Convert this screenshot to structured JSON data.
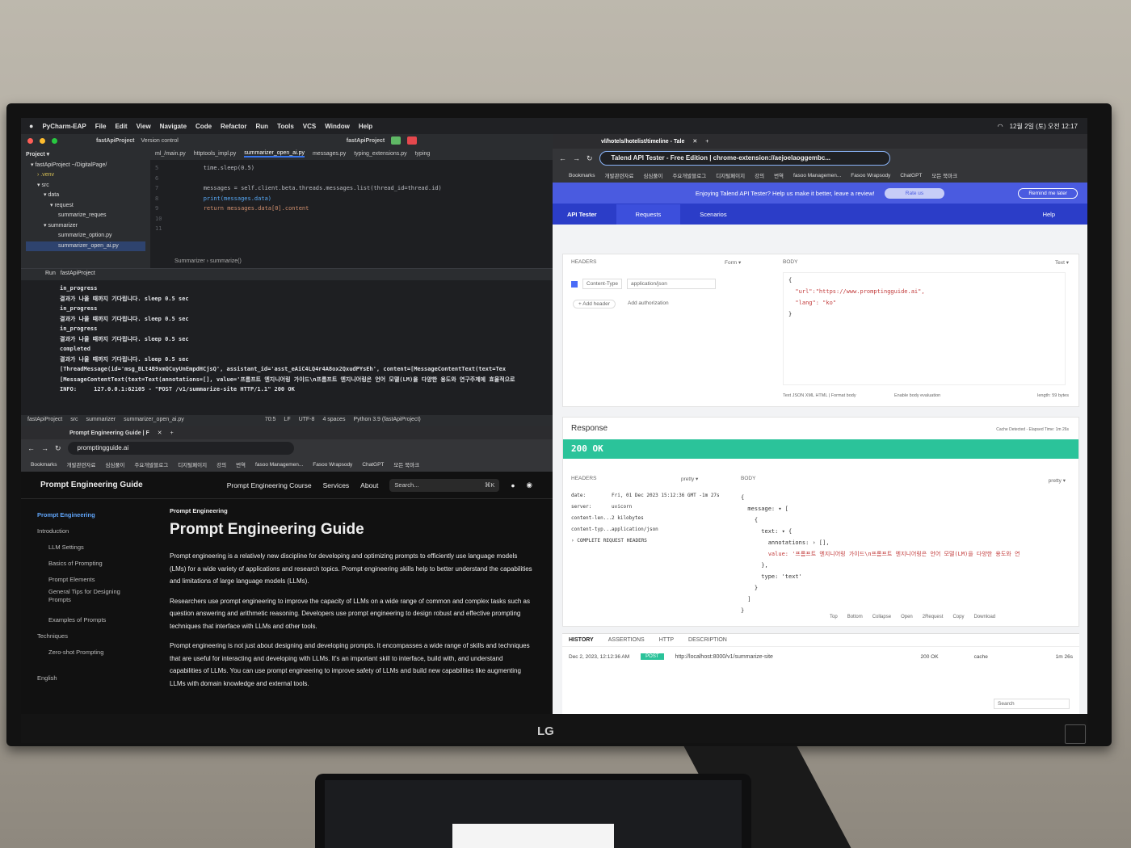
{
  "menubar": {
    "items": [
      "PyCharm-EAP",
      "File",
      "Edit",
      "View",
      "Navigate",
      "Code",
      "Refactor",
      "Run",
      "Tools",
      "VCS",
      "Window",
      "Help"
    ],
    "clock": "12월 2일 (토) 오전 12:17"
  },
  "ide": {
    "project": "fastApiProject",
    "vcs": "Version control",
    "tree": [
      "Project ▾",
      "▾ fastApiProject ~/DigitalPage/",
      "› .venv",
      "▾ src",
      "▾ data",
      "▾ request",
      "summarize_reques",
      "▾ summarizer",
      "summarize_option.py",
      "summarizer_open_ai.py"
    ],
    "tabs": [
      "ml_/main.py",
      "httptools_impl.py",
      "summarizer_open_ai.py",
      "messages.py",
      "typing_extensions.py",
      "typing"
    ],
    "line_numbers": [
      "5",
      "6",
      "7",
      "8",
      "9",
      "10",
      "11"
    ],
    "code": [
      "        time.sleep(0.5)",
      "",
      "        messages = self.client.beta.threads.messages.list(thread_id=thread.id)",
      "        print(messages.data)",
      "        return messages.data[0].content",
      "",
      ""
    ],
    "breadcrumb": "Summarizer  ›  summarize()",
    "run_title": "fastApiProject",
    "terminal": [
      "in_progress",
      "결과가 나올 때까지 기다립니다. sleep 0.5 sec",
      "in_progress",
      "결과가 나올 때까지 기다립니다. sleep 0.5 sec",
      "in_progress",
      "결과가 나올 때까지 기다립니다. sleep 0.5 sec",
      "completed",
      "결과가 나올 때까지 기다립니다. sleep 0.5 sec",
      "[ThreadMessage(id='msg_BLt4B9xmQCuyUnEmpdHCjsQ', assistant_id='asst_eAiC4LQ4r4A8ox2QxudPYsEh', content=[MessageContentText(text=Tex",
      "[MessageContentText(text=Text(annotations=[], value='프롬프트 엔지니어링 가이드\\n프롬프트 엔지니어링은 언어 모델(LM)을 다양한 용도와 연구주제에 효율적으로 ",
      "INFO:     127.0.0.1:62105 - \"POST /v1/summarize-site HTTP/1.1\" 200 OK"
    ],
    "status": [
      "fastApiProject",
      "src",
      "summarizer",
      "summarizer_open_ai.py",
      "70:5",
      "LF",
      "UTF-8",
      "4 spaces",
      "Python 3.9 (fastApiProject)"
    ]
  },
  "lower_browser": {
    "tab": "Prompt Engineering Guide | F",
    "url": "promptingguide.ai",
    "bookmarks": [
      "Bookmarks",
      "개발관련자료",
      "심심풀이",
      "주요개발블로그",
      "디지털페이지",
      "강의",
      "번역",
      "fasoo Managemen...",
      "Fasoo Wrapsody",
      "ChatGPT",
      "모든 북마크"
    ],
    "site": {
      "brand": "Prompt Engineering Guide",
      "nav": [
        "Prompt Engineering Course",
        "Services",
        "About"
      ],
      "search": "Search...",
      "kbd": "⌘K",
      "side": [
        "Prompt Engineering",
        "Introduction",
        "LLM Settings",
        "Basics of Prompting",
        "Prompt Elements",
        "General Tips for Designing Prompts",
        "Examples of Prompts",
        "Techniques",
        "Zero-shot Prompting"
      ],
      "lang": "English",
      "crumb": "Prompt Engineering",
      "h1": "Prompt Engineering Guide",
      "p1": "Prompt engineering is a relatively new discipline for developing and optimizing prompts to efficiently use language models (LMs) for a wide variety of applications and research topics. Prompt engineering skills help to better understand the capabilities and limitations of large language models (LLMs).",
      "p2": "Researchers use prompt engineering to improve the capacity of LLMs on a wide range of common and complex tasks such as question answering and arithmetic reasoning. Developers use prompt engineering to design robust and effective prompting techniques that interface with LLMs and other tools.",
      "p3": "Prompt engineering is not just about designing and developing prompts. It encompasses a wide range of skills and techniques that are useful for interacting and developing with LLMs. It's an important skill to interface, build with, and understand capabilities of LLMs. You can use prompt engineering to improve safety of LLMs and build new capabilities like augmenting LLMs with domain knowledge and external tools."
    }
  },
  "right_browser": {
    "tab": "vl/hotels/hotelist/timeline - Tale",
    "url": "Talend API Tester - Free Edition  |  chrome-extension://aejoelaoggembc...",
    "bookmarks": [
      "Bookmarks",
      "개발관련자료",
      "심심풀이",
      "주요개발블로그",
      "디지털페이지",
      "강의",
      "번역",
      "fasoo Managemen...",
      "Fasoo Wrapsody",
      "ChatGPT",
      "모든 북마크"
    ],
    "banner": "Enjoying Talend API Tester? Help us make it better, leave a review!",
    "rate": "Rate us",
    "remind": "Remind me later",
    "tabs": [
      "API Tester",
      "Requests",
      "Scenarios"
    ],
    "help": "Help",
    "request": {
      "headers_label": "HEADERS",
      "form": "Form ▾",
      "header_name": "Content-Type",
      "header_value": "application/json",
      "add_header": "+ Add header",
      "add_auth": "Add authorization",
      "body_label": "BODY",
      "text": "Text ▾",
      "body_lines": [
        "{",
        "  \"url\":\"https://www.promptingguide.ai\",",
        "  \"lang\": \"ko\"",
        "}"
      ],
      "foot": "Text  JSON  XML  HTML  |   Format body",
      "eval": "Enable body evaluation",
      "length": "length: 59 bytes"
    },
    "response": {
      "title": "Response",
      "meta": "Cache Detected - Elapsed Time: 1m 26s",
      "status": "200 OK",
      "headers_label": "HEADERS",
      "pretty": "pretty ▾",
      "body_label": "BODY",
      "headers": [
        [
          "date:",
          "Fri, 01 Dec 2023 15:12:36 GMT -1m 27s"
        ],
        [
          "server:",
          "uvicorn"
        ],
        [
          "content-len...",
          "2 kilobytes"
        ],
        [
          "content-typ...",
          "application/json"
        ]
      ],
      "complete": "› COMPLETE REQUEST HEADERS",
      "body": [
        "{",
        "  message: ▾ [",
        "    {",
        "      text: ▾ {",
        "        annotations: › [],",
        "        value: '프롬프트 엔지니어링 가이드\\n프롬프트 엔지니어링은 언어 모델(LM)을 다양한 용도와 연",
        "      },",
        "      type: 'text'",
        "    }",
        "  ]",
        "}"
      ],
      "actions": [
        "Top",
        "Bottom",
        "Collapse",
        "Open",
        "2Request",
        "Copy",
        "Download"
      ]
    },
    "history": {
      "tabs": [
        "HISTORY",
        "ASSERTIONS",
        "HTTP",
        "DESCRIPTION"
      ],
      "date": "Dec 2, 2023, 12:12:36 AM",
      "method": "POST",
      "url": "http://localhost:8000/v1/summarize-site",
      "code": "200 OK",
      "cache": "cache",
      "time": "1m 26s",
      "search": "Search"
    }
  },
  "monitor": {
    "brand": "LG"
  }
}
